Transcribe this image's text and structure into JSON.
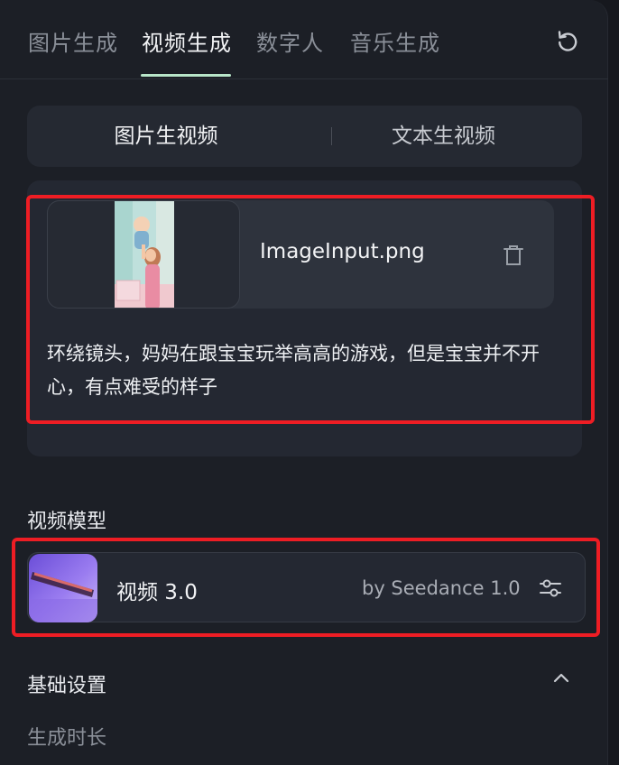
{
  "tabs": [
    {
      "label": "图片生成",
      "active": false
    },
    {
      "label": "视频生成",
      "active": true
    },
    {
      "label": "数字人",
      "active": false
    },
    {
      "label": "音乐生成",
      "active": false
    }
  ],
  "mode_switch": {
    "left_label": "图片生视频",
    "right_label": "文本生视频",
    "selected": "图片生视频"
  },
  "input": {
    "file_name": "ImageInput.png",
    "prompt": "环绕镜头，妈妈在跟宝宝玩举高高的游戏，但是宝宝并不开心，有点难受的样子"
  },
  "model_section": {
    "title": "视频模型",
    "model_name": "视频 3.0",
    "model_by": "by Seedance 1.0"
  },
  "basic_settings": {
    "title": "基础设置",
    "duration_label": "生成时长"
  },
  "icons": {
    "refresh": "refresh-icon",
    "trash": "trash-icon",
    "settings": "sliders-icon",
    "collapse": "chevron-up-icon"
  },
  "colors": {
    "accent_underline": "#b8e6c9",
    "annotation_red": "#ee1d24",
    "panel_bg": "#1c1f26"
  }
}
